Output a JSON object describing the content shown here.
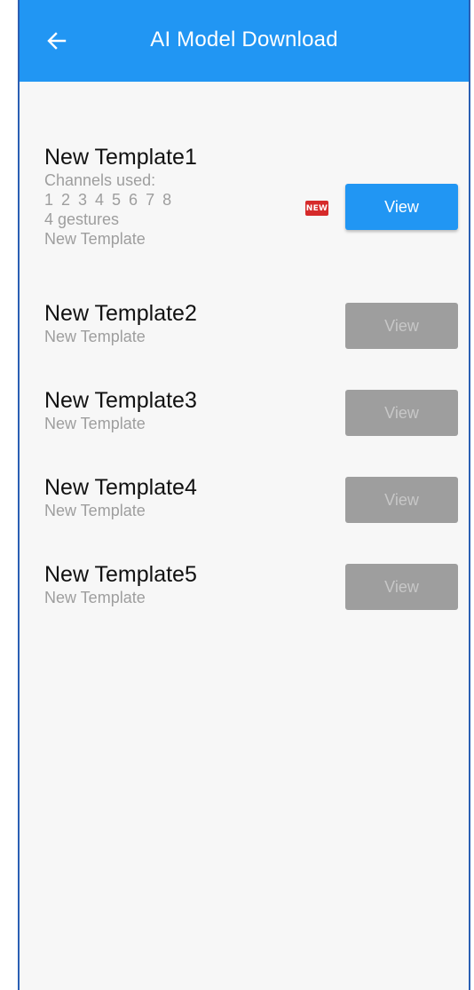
{
  "appbar": {
    "title": "AI Model Download",
    "back_icon": "arrow-left-icon",
    "color": "#2196f3"
  },
  "templates": [
    {
      "title": "New Template1",
      "channels_label": "Channels used:",
      "channels": "1 2 3 4 5 6 7 8",
      "gestures": "4 gestures",
      "subtitle": "New Template",
      "badge": "NEW",
      "button_label": "View",
      "button_state": "active"
    },
    {
      "title": "New Template2",
      "subtitle": "New Template",
      "button_label": "View",
      "button_state": "disabled"
    },
    {
      "title": "New Template3",
      "subtitle": "New Template",
      "button_label": "View",
      "button_state": "disabled"
    },
    {
      "title": "New Template4",
      "subtitle": "New Template",
      "button_label": "View",
      "button_state": "disabled"
    },
    {
      "title": "New Template5",
      "subtitle": "New Template",
      "button_label": "View",
      "button_state": "disabled"
    }
  ],
  "colors": {
    "accent": "#2196f3",
    "badge": "#d62a2a",
    "disabled_button": "#9e9e9e"
  }
}
